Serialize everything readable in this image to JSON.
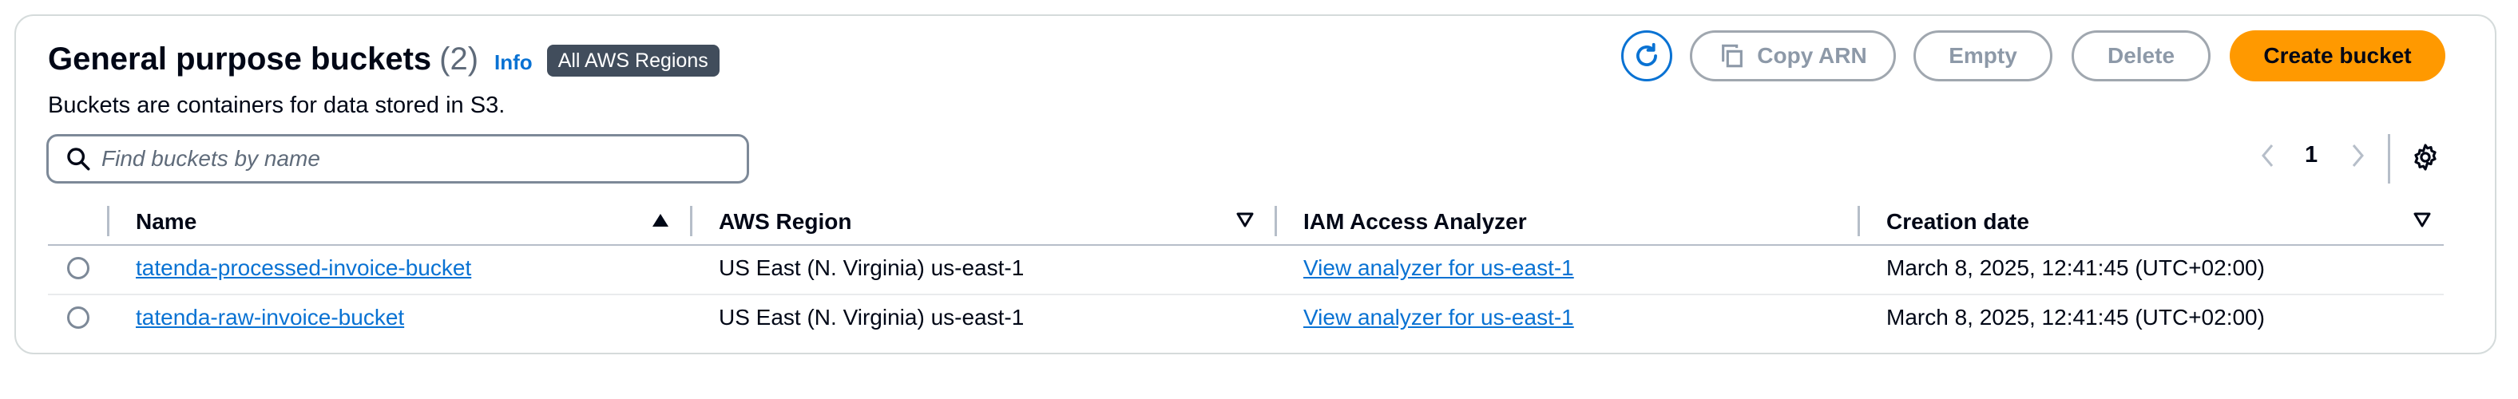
{
  "header": {
    "title": "General purpose buckets",
    "count": "(2)",
    "info_label": "Info",
    "region_badge": "All AWS Regions",
    "description": "Buckets are containers for data stored in S3."
  },
  "toolbar": {
    "copy_arn_label": "Copy ARN",
    "empty_label": "Empty",
    "delete_label": "Delete",
    "create_label": "Create bucket"
  },
  "search": {
    "placeholder": "Find buckets by name",
    "value": ""
  },
  "pagination": {
    "current_page": "1"
  },
  "table": {
    "columns": [
      "Name",
      "AWS Region",
      "IAM Access Analyzer",
      "Creation date"
    ],
    "rows": [
      {
        "name": "tatenda-processed-invoice-bucket",
        "region": "US East (N. Virginia) us-east-1",
        "analyzer": "View analyzer for us-east-1",
        "created": "March 8, 2025, 12:41:45 (UTC+02:00)"
      },
      {
        "name": "tatenda-raw-invoice-bucket",
        "region": "US East (N. Virginia) us-east-1",
        "analyzer": "View analyzer for us-east-1",
        "created": "March 8, 2025, 12:41:45 (UTC+02:00)"
      }
    ]
  },
  "colors": {
    "primary_button": "#ff9900",
    "link": "#0972d3",
    "badge": "#414d5c"
  }
}
